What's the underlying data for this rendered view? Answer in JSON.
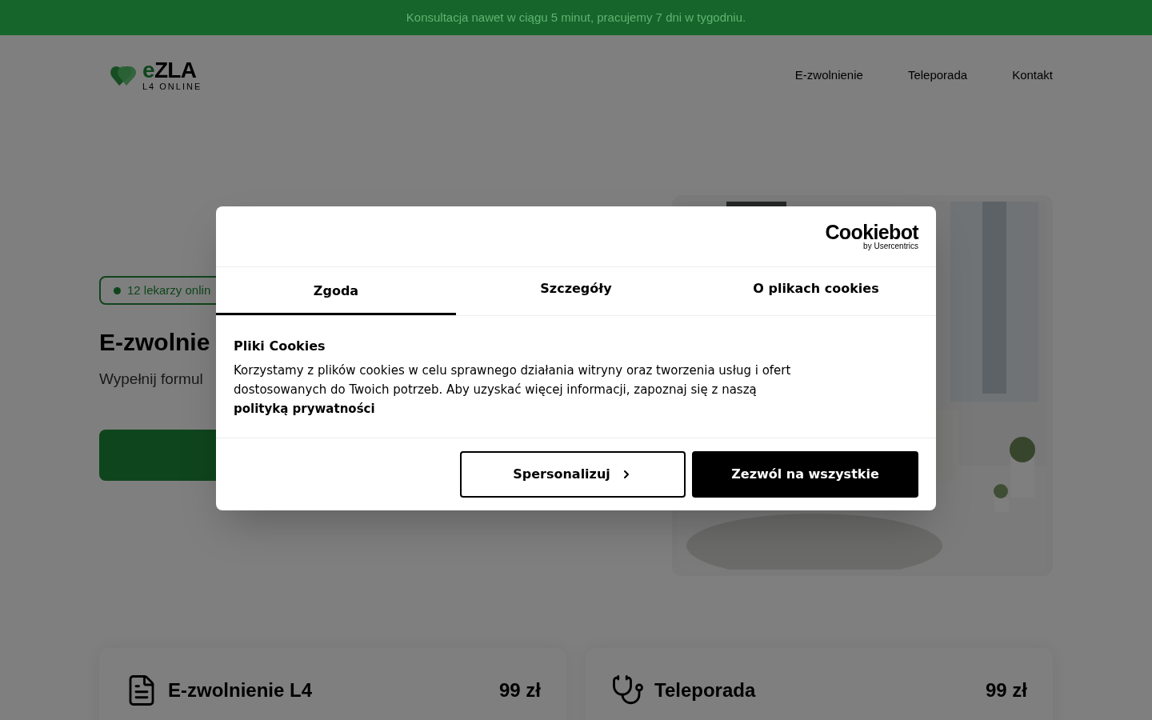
{
  "announcement": "Konsultacja nawet w ciągu 5 minut, pracujemy 7 dni w tygodniu.",
  "logo": {
    "prefix": "e",
    "name": "ZLA",
    "tagline": "L4 ONLINE"
  },
  "nav": [
    "E-zwolnienie",
    "Teleporada",
    "Kontakt"
  ],
  "hero": {
    "badge": "12 lekarzy onlin",
    "title": "E-zwolnie",
    "subtitle": "Wypełnij formul"
  },
  "services": [
    {
      "kind": "document",
      "title": "E-zwolnienie L4",
      "price": "99 zł"
    },
    {
      "kind": "stethoscope",
      "title": "Teleporada",
      "price": "99 zł"
    }
  ],
  "cookie_dialog": {
    "brand": "Cookiebot",
    "brand_sub": "by Usercentrics",
    "tabs": [
      {
        "label": "Zgoda",
        "selected": true
      },
      {
        "label": "Szczegóły",
        "selected": false
      },
      {
        "label": "O plikach cookies",
        "selected": false
      }
    ],
    "heading": "Pliki Cookies",
    "body": "Korzystamy z plików cookies w celu sprawnego działania witryny oraz tworzenia usług i ofert dostosowanych do Twoich potrzeb. Aby uzyskać więcej informacji, zapoznaj się z naszą",
    "link": "polityką prywatności",
    "buttons": [
      {
        "kind": "outline",
        "label": "Spersonalizuj"
      },
      {
        "kind": "solid",
        "label": "Zezwól na wszystkie"
      }
    ]
  }
}
